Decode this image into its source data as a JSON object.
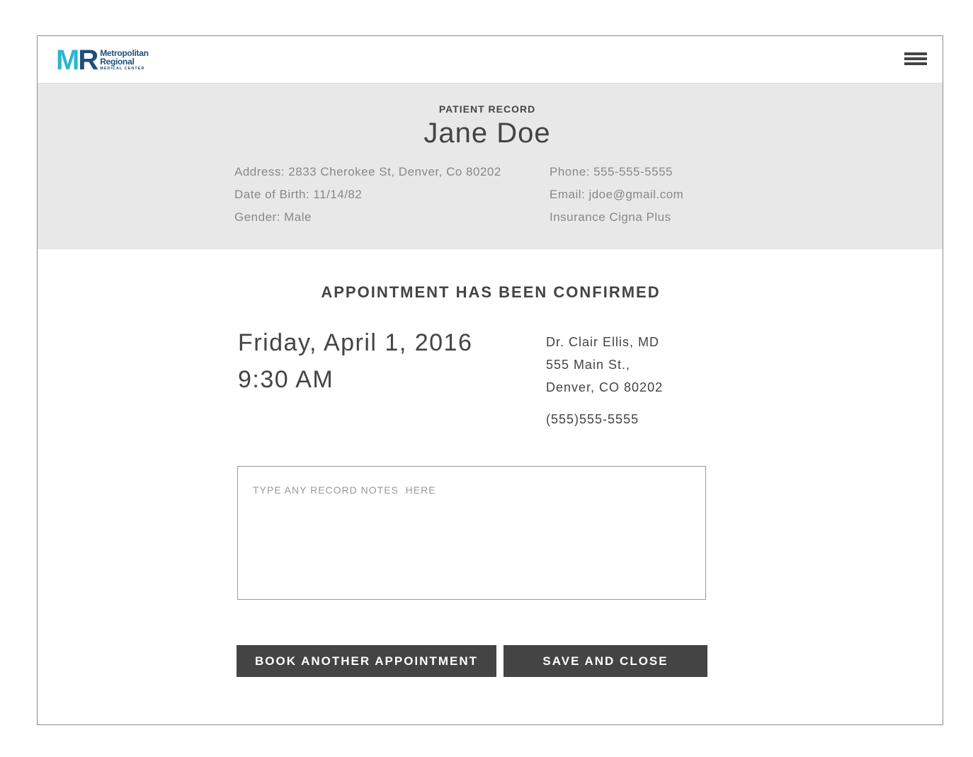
{
  "header": {
    "logo": {
      "mark_m": "M",
      "mark_r": "R",
      "line1": "Metropolitan",
      "line2": "Regional",
      "line3": "MEDICAL CENTER"
    },
    "menu_icon": "hamburger-menu-icon"
  },
  "patient": {
    "section_label": "PATIENT RECORD",
    "name": "Jane Doe",
    "address": "Address: 2833 Cherokee St, Denver, Co 80202",
    "dob": "Date of Birth: 11/14/82",
    "gender": "Gender: Male",
    "phone": "Phone: 555-555-5555",
    "email": "Email: jdoe@gmail.com",
    "insurance": "Insurance Cigna Plus"
  },
  "confirmation": {
    "title": "APPOINTMENT HAS BEEN CONFIRMED",
    "date": "Friday, April 1, 2016",
    "time": "9:30 AM",
    "doctor_name": "Dr. Clair Ellis, MD",
    "doctor_street": "555 Main St.,",
    "doctor_city": "Denver, CO 80202",
    "doctor_phone": "(555)555-5555"
  },
  "notes": {
    "placeholder": "TYPE ANY RECORD NOTES  HERE",
    "value": ""
  },
  "actions": {
    "book_another_label": "BOOK ANOTHER APPOINTMENT",
    "save_close_label": "SAVE AND CLOSE"
  },
  "colors": {
    "logo_teal": "#2bb7cf",
    "logo_navy": "#1f4f7a",
    "header_band": "#e8e8e8",
    "button_bg": "#444444",
    "text_dark": "#444444",
    "text_muted": "#888888"
  }
}
